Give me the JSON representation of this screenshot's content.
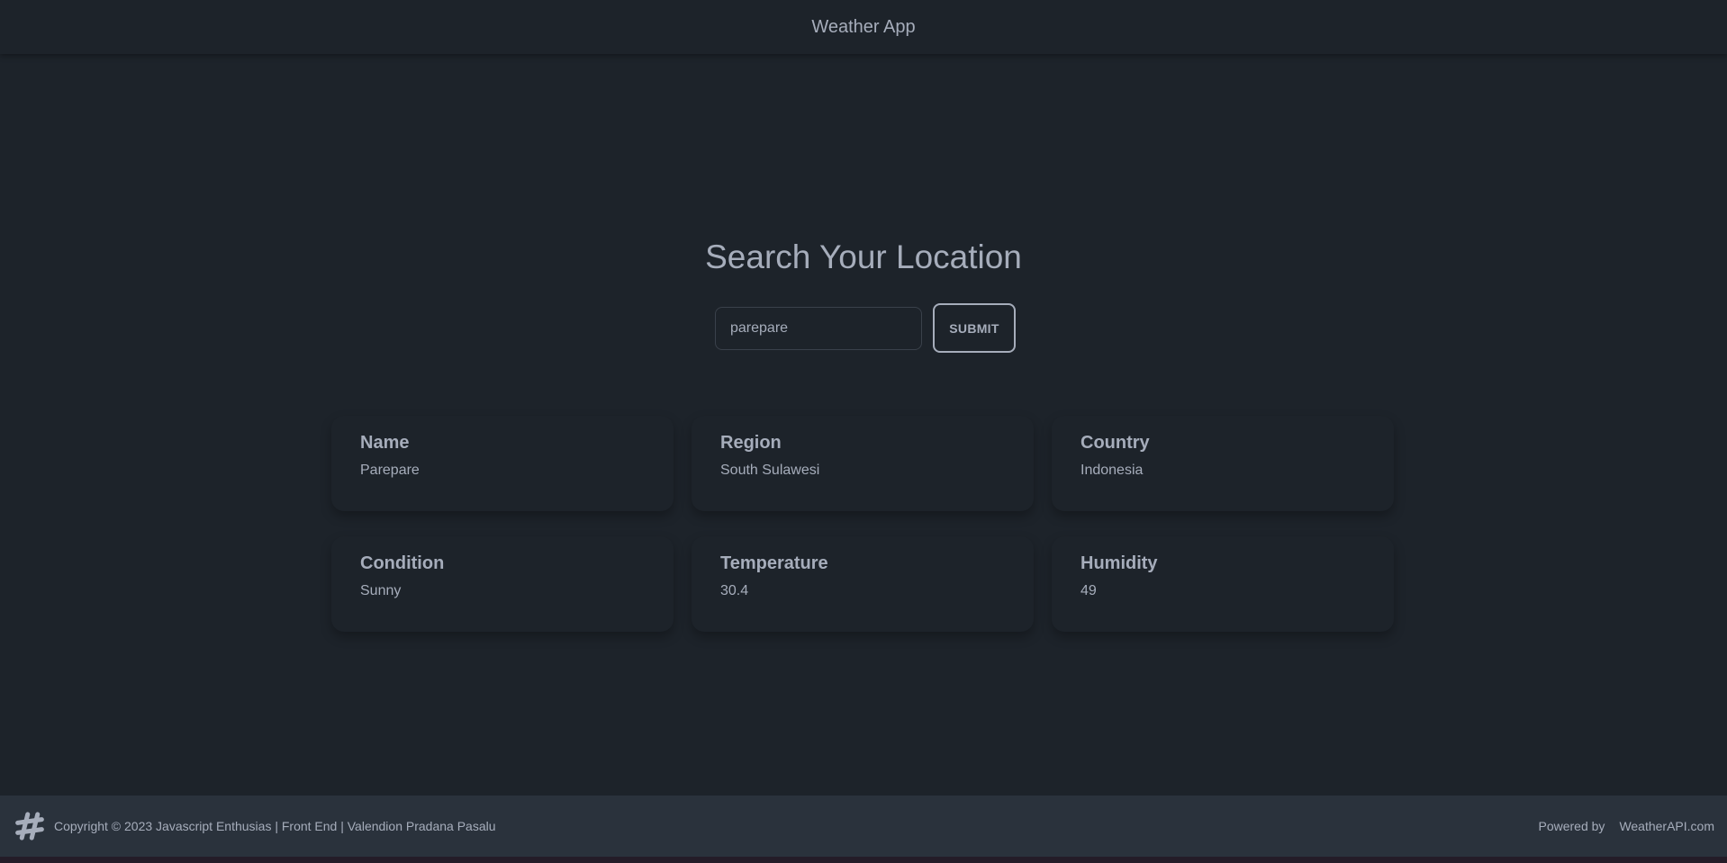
{
  "header": {
    "title": "Weather App"
  },
  "search": {
    "heading": "Search Your Location",
    "value": "parepare",
    "submit_label": "SUBMIT"
  },
  "cards": [
    {
      "label": "Name",
      "value": "Parepare"
    },
    {
      "label": "Region",
      "value": "South Sulawesi"
    },
    {
      "label": "Country",
      "value": "Indonesia"
    },
    {
      "label": "Condition",
      "value": "Sunny"
    },
    {
      "label": "Temperature",
      "value": "30.4"
    },
    {
      "label": "Humidity",
      "value": "49"
    }
  ],
  "footer": {
    "logo_icon": "hashtag-logo-icon",
    "copyright": "Copyright © 2023 Javascript Enthusias | Front End | Valendion Pradana Pasalu",
    "powered_by": "Powered by",
    "provider": "WeatherAPI.com"
  },
  "colors": {
    "background": "#1d232a",
    "text": "#a6adbb",
    "footer_background": "#2a323c"
  }
}
